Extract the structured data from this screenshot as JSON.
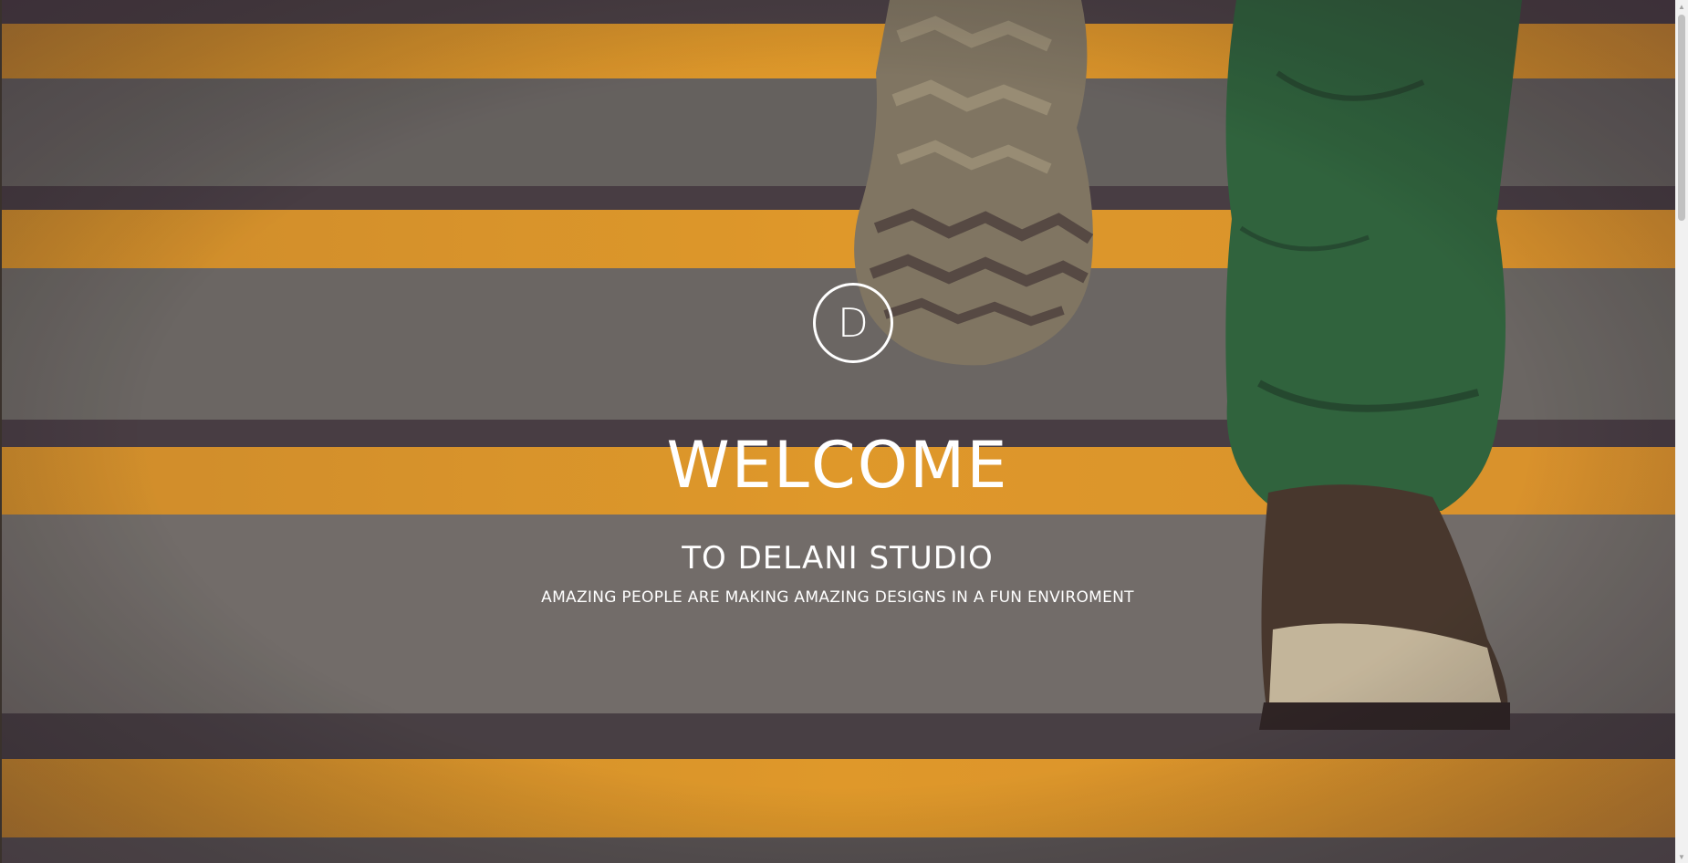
{
  "hero": {
    "logo_letter": "D",
    "title": "WELCOME",
    "subtitle": "TO DELANI STUDIO",
    "tagline": "AMAZING PEOPLE ARE MAKING AMAZING DESIGNS IN A FUN ENVIROMENT"
  },
  "background": {
    "subject": "person-climbing-stairs-photo",
    "stair_stripe_color": "#f5a623",
    "stair_step_color": "#6e6b66",
    "pants_color": "#2f6b3c",
    "shoe_color": "#4a3a2c"
  },
  "scrollbar": {
    "up_icon": "scroll-up-arrow-icon",
    "down_icon": "scroll-down-arrow-icon"
  }
}
